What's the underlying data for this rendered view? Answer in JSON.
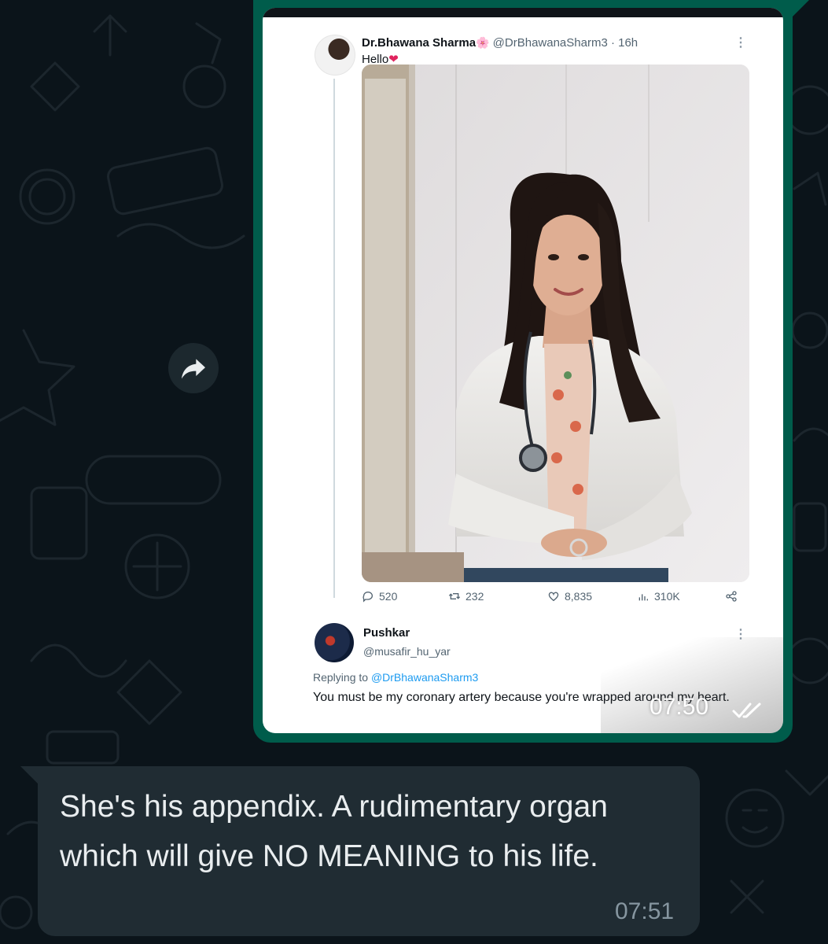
{
  "tweet": {
    "author_name": "Dr.Bhawana Sharma",
    "author_emoji": "🌸",
    "meta": "@DrBhawanaSharm3 · 16h",
    "text": "Hello",
    "text_emoji": "❤",
    "more": "⋮",
    "stats": {
      "replies": "520",
      "retweets": "232",
      "likes": "8,835",
      "views": "310K"
    }
  },
  "reply": {
    "author_name": "Pushkar",
    "handle": "@musafir_hu_yar",
    "replying_label": "Replying to",
    "replying_to": "@DrBhawanaSharm3",
    "text": "You must be my coronary artery because you're wrapped around my heart."
  },
  "outgoing_message": {
    "time": "07:50",
    "status": "read"
  },
  "incoming_message": {
    "text": "She's his appendix. A rudimentary organ which will give NO MEANING to his life.",
    "time": "07:51"
  },
  "colors": {
    "background": "#0b141a",
    "outgoing_bubble": "#005c4b",
    "incoming_bubble": "#202c33",
    "link": "#1d9bf0"
  }
}
